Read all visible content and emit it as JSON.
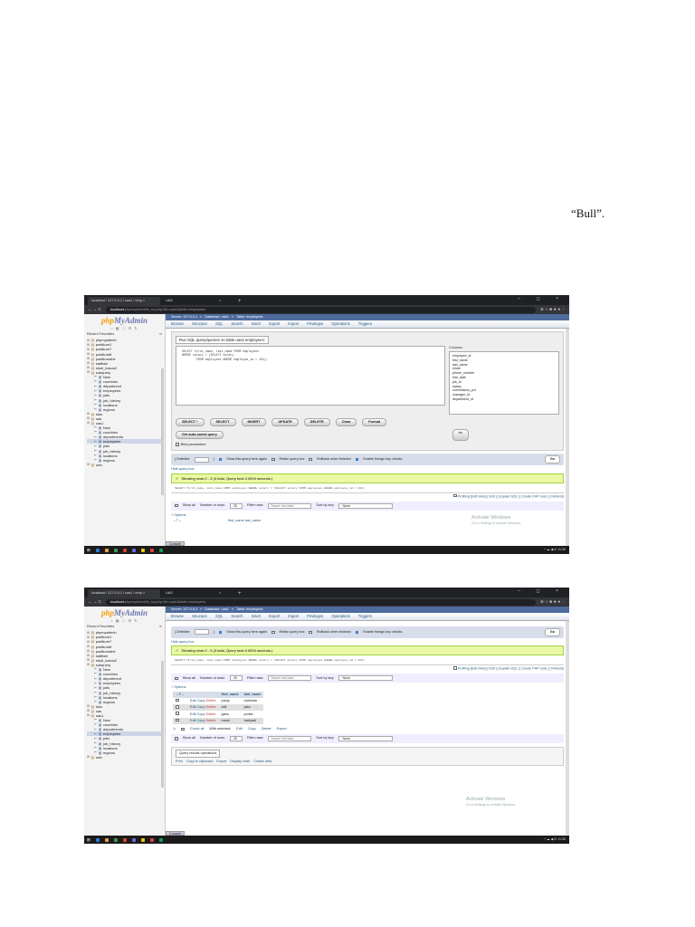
{
  "page_text": "“Bull”.",
  "browser": {
    "tab1": "localhost / 127.0.0.1 / uas1 / emp ×",
    "tab2": "UAS",
    "tab2_close": "×",
    "new_tab": "+",
    "window_controls": "– ◻ ×",
    "nav_arrows": "← → C",
    "url_host": "localhost",
    "url_path": "/phpmyadmin/tbl_sql.php?db=uas1&table=employees",
    "icons": "⊕ ☆ ■ ★ ● ⋮"
  },
  "pma": {
    "logo_php": "php",
    "logo_myadmin": "MyAdmin",
    "nav_icons": "⌂ ▦ ⓘ ⚙ ↻",
    "recent": "Recent",
    "favorites": "Favorites",
    "collapse": "∞",
    "tree1": [
      {
        "label": "phpmyadmin",
        "level": 0,
        "type": "db"
      },
      {
        "label": "pratikum1",
        "level": 0,
        "type": "db"
      },
      {
        "label": "pratikum7",
        "level": 0,
        "type": "db"
      },
      {
        "label": "pratikum8",
        "level": 0,
        "type": "db"
      },
      {
        "label": "pratikumahir",
        "level": 0,
        "type": "db"
      },
      {
        "label": "staffdat",
        "level": 0,
        "type": "db"
      },
      {
        "label": "studi_kasus2",
        "level": 0,
        "type": "db"
      },
      {
        "label": "subquery",
        "level": 0,
        "type": "db"
      },
      {
        "label": "New",
        "level": 1,
        "type": "tbl"
      },
      {
        "label": "countries",
        "level": 1,
        "type": "tbl"
      },
      {
        "label": "department",
        "level": 1,
        "type": "tbl"
      },
      {
        "label": "employees",
        "level": 1,
        "type": "tbl"
      },
      {
        "label": "jobs",
        "level": 1,
        "type": "tbl"
      },
      {
        "label": "job_history",
        "level": 1,
        "type": "tbl"
      },
      {
        "label": "locations",
        "level": 1,
        "type": "tbl"
      },
      {
        "label": "regions",
        "level": 1,
        "type": "tbl"
      },
      {
        "label": "toko",
        "level": 0,
        "type": "db"
      },
      {
        "label": "uas",
        "level": 0,
        "type": "db"
      },
      {
        "label": "uas1",
        "level": 0,
        "type": "db"
      },
      {
        "label": "New",
        "level": 1,
        "type": "tbl"
      },
      {
        "label": "countries",
        "level": 1,
        "type": "tbl"
      },
      {
        "label": "departments",
        "level": 1,
        "type": "tbl"
      },
      {
        "label": "employees",
        "level": 1,
        "type": "tbl",
        "selected": true
      },
      {
        "label": "jobs",
        "level": 1,
        "type": "tbl"
      },
      {
        "label": "job_history",
        "level": 1,
        "type": "tbl"
      },
      {
        "label": "locations",
        "level": 1,
        "type": "tbl"
      },
      {
        "label": "regions",
        "level": 1,
        "type": "tbl"
      },
      {
        "label": "univ",
        "level": 0,
        "type": "db"
      }
    ],
    "tree2": [
      {
        "label": "phpmyadmin",
        "level": 0,
        "type": "db"
      },
      {
        "label": "pratikum1",
        "level": 0,
        "type": "db"
      },
      {
        "label": "pratikum7",
        "level": 0,
        "type": "db"
      },
      {
        "label": "pratikum8",
        "level": 0,
        "type": "db"
      },
      {
        "label": "pratikumahir",
        "level": 0,
        "type": "db"
      },
      {
        "label": "staffdat",
        "level": 0,
        "type": "db"
      },
      {
        "label": "studi_kasus2",
        "level": 0,
        "type": "db"
      },
      {
        "label": "subquery",
        "level": 0,
        "type": "db"
      },
      {
        "label": "New",
        "level": 1,
        "type": "tbl"
      },
      {
        "label": "countries",
        "level": 1,
        "type": "tbl"
      },
      {
        "label": "department",
        "level": 1,
        "type": "tbl"
      },
      {
        "label": "employees",
        "level": 1,
        "type": "tbl"
      },
      {
        "label": "jobs",
        "level": 1,
        "type": "tbl"
      },
      {
        "label": "job_history",
        "level": 1,
        "type": "tbl"
      },
      {
        "label": "locations",
        "level": 1,
        "type": "tbl"
      },
      {
        "label": "regions",
        "level": 1,
        "type": "tbl"
      },
      {
        "label": "toko",
        "level": 0,
        "type": "db"
      },
      {
        "label": "uas",
        "level": 0,
        "type": "db"
      },
      {
        "label": "uas1",
        "level": 0,
        "type": "db"
      },
      {
        "label": "New",
        "level": 1,
        "type": "tbl"
      },
      {
        "label": "countries",
        "level": 1,
        "type": "tbl"
      },
      {
        "label": "departments",
        "level": 1,
        "type": "tbl"
      },
      {
        "label": "employees",
        "level": 1,
        "type": "tbl",
        "selected": true
      },
      {
        "label": "jobs",
        "level": 1,
        "type": "tbl"
      },
      {
        "label": "job_history",
        "level": 1,
        "type": "tbl"
      },
      {
        "label": "locations",
        "level": 1,
        "type": "tbl"
      },
      {
        "label": "regions",
        "level": 1,
        "type": "tbl"
      },
      {
        "label": "univ",
        "level": 0,
        "type": "db"
      }
    ],
    "breadcrumb": {
      "server": "Server: 127.0.0.1",
      "database": "Database: uas1",
      "table": "Table: employees",
      "sep": "»"
    },
    "menu": [
      "Browse",
      "Structure",
      "SQL",
      "Search",
      "Insert",
      "Export",
      "Import",
      "Privileges",
      "Operations",
      "Triggers"
    ],
    "sql_title": "Run SQL query/queries on table uas1.employees:",
    "sql_text": "SELECT first_name, last_name FROM employees\nWHERE salary = (SELECT salary\n        FROM employees WHERE employee_id = 101);",
    "columns_title": "Columns",
    "columns": [
      "employee_id",
      "first_name",
      "last_name",
      "email",
      "phone_number",
      "hire_date",
      "job_id",
      "salary",
      "commission_pct",
      "manager_id",
      "department_id"
    ],
    "sql_buttons": [
      "SELECT *",
      "SELECT",
      "INSERT",
      "UPDATE",
      "DELETE",
      "Clear",
      "Format"
    ],
    "insert_btn": "<<",
    "auto_btn": "Get auto-saved query",
    "bind_params": "Bind parameters",
    "delimiter": "[ Delimiter",
    "delimiter_close": "]",
    "opt_show": "Show this query here again",
    "opt_retain": "Retain query box",
    "opt_rollback": "Rollback when finished",
    "opt_fk": "Enable foreign key checks",
    "go": "Go",
    "hide_query": "Hide query box",
    "success": "Showing rows 0 - 3 (4 total, Query took 0.0004 seconds.)",
    "success2": "Showing rows 0 - 3 (4 total, Query took 0.0004 seconds.)",
    "executed_sql": "SELECT first_name, last_name FROM employees WHERE salary = (SELECT salary FROM employees WHERE employee_id = 101)",
    "profiling": "Profiling [Edit inline] [ Edit ] [ Explain SQL ] [ Create PHP code ] [ Refresh]",
    "show_all": "Show all",
    "num_rows_label": "Number of rows:",
    "num_rows": "25",
    "filter_label": "Filter rows:",
    "filter_placeholder": "Search this table",
    "sort_label": "Sort by key:",
    "sort_value": "None",
    "options": "+ Options",
    "col_first": "first_name",
    "col_last": "last_name",
    "arrows": "←T→",
    "rows": [
      {
        "first": "panjo",
        "last": "budiman"
      },
      {
        "first": "ahli",
        "last": "jaka"
      },
      {
        "first": "gans",
        "last": "junkie"
      },
      {
        "first": "mesti",
        "last": "hariyadi"
      }
    ],
    "row_edit": "Edit",
    "row_copy": "Copy",
    "row_delete": "Delete",
    "check_all": "Check all",
    "with_selected": "With selected:",
    "bulk_edit": "Edit",
    "bulk_copy": "Copy",
    "bulk_delete": "Delete",
    "bulk_export": "Export",
    "qro_title": "Query results operations",
    "qro_links": [
      "Print",
      "Copy to clipboard",
      "Export",
      "Display chart",
      "Create view"
    ],
    "console": "Console",
    "watermark_title": "Activate Windows",
    "watermark_sub": "Go to Settings to activate Windows.",
    "tray": "^ ☁ ◀ ⊡ 11:30"
  },
  "colors": {
    "pma_blue": "#235a81",
    "success_bg": "#ebf8a4",
    "crumb": "#4e6b9e"
  }
}
